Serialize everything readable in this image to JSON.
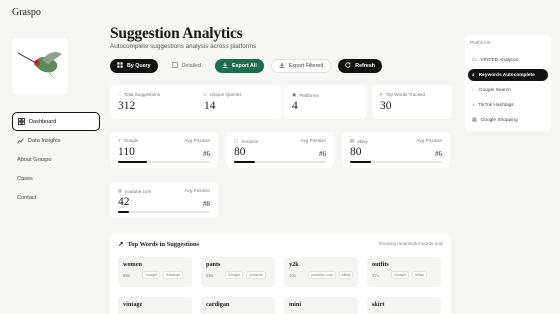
{
  "brand": "Graspo",
  "nav": [
    {
      "label": "Dashboard",
      "icon": "dashboard-icon",
      "active": true
    },
    {
      "label": "Data Insights",
      "icon": "chart-icon",
      "active": false
    },
    {
      "label": "About Graspo",
      "icon": "",
      "active": false
    },
    {
      "label": "Cases",
      "icon": "",
      "active": false
    },
    {
      "label": "Contact",
      "icon": "",
      "active": false
    }
  ],
  "header": {
    "title": "Suggestion Analytics",
    "subtitle": "Autocomplete suggestions analysis across platforms"
  },
  "toolbar": {
    "by_query": "By Query",
    "detailed": "Detailed",
    "export_all": "Export All",
    "export_filtered": "Export Filtered",
    "refresh": "Refresh"
  },
  "stats": [
    {
      "label": "Total Suggestions",
      "value": "312"
    },
    {
      "label": "Unique Queries",
      "value": "14"
    },
    {
      "label": "Platforms",
      "value": "4"
    },
    {
      "label": "Top Words Tracked",
      "value": "30"
    }
  ],
  "platforms": [
    {
      "name": "Google",
      "avg_label": "Avg Position",
      "value": "110",
      "rank": "#6",
      "progress": 0.32
    },
    {
      "name": "Amazon",
      "avg_label": "Avg Position",
      "value": "80",
      "rank": "#6",
      "progress": 0.23
    },
    {
      "name": "eBay",
      "avg_label": "Avg Position",
      "value": "80",
      "rank": "#6",
      "progress": 0.23
    },
    {
      "name": "youtube.com",
      "avg_label": "Avg Position",
      "value": "42",
      "rank": "#8",
      "progress": 0.12
    }
  ],
  "right_panel": {
    "heading": "Platforms",
    "items": [
      {
        "label": "VINTED Analytics",
        "icon": "vinted-icon",
        "active": false
      },
      {
        "label": "Keywords Autocomplete",
        "icon": "search-icon",
        "active": true
      },
      {
        "label": "Google Search",
        "icon": "google-icon",
        "active": false
      },
      {
        "label": "TikTok Hashtags",
        "icon": "tiktok-icon",
        "active": false
      },
      {
        "label": "Google Shopping",
        "icon": "cart-icon",
        "active": false
      }
    ]
  },
  "top_words": {
    "heading": "Top Words in Suggestions",
    "note": "Showing meaningful words only",
    "items": [
      {
        "word": "women",
        "count": "98x",
        "tags": [
          "Google",
          "Amazon"
        ]
      },
      {
        "word": "pants",
        "count": "59x",
        "tags": [
          "Google",
          "Amazon"
        ]
      },
      {
        "word": "y2k",
        "count": "40x",
        "tags": [
          "youtube.com",
          "eBay"
        ]
      },
      {
        "word": "outfits",
        "count": "37x",
        "tags": [
          "Google",
          "eBay"
        ]
      },
      {
        "word": "vintage",
        "count": "",
        "tags": []
      },
      {
        "word": "cardigan",
        "count": "",
        "tags": []
      },
      {
        "word": "mini",
        "count": "",
        "tags": []
      },
      {
        "word": "skirt",
        "count": "",
        "tags": []
      }
    ]
  }
}
